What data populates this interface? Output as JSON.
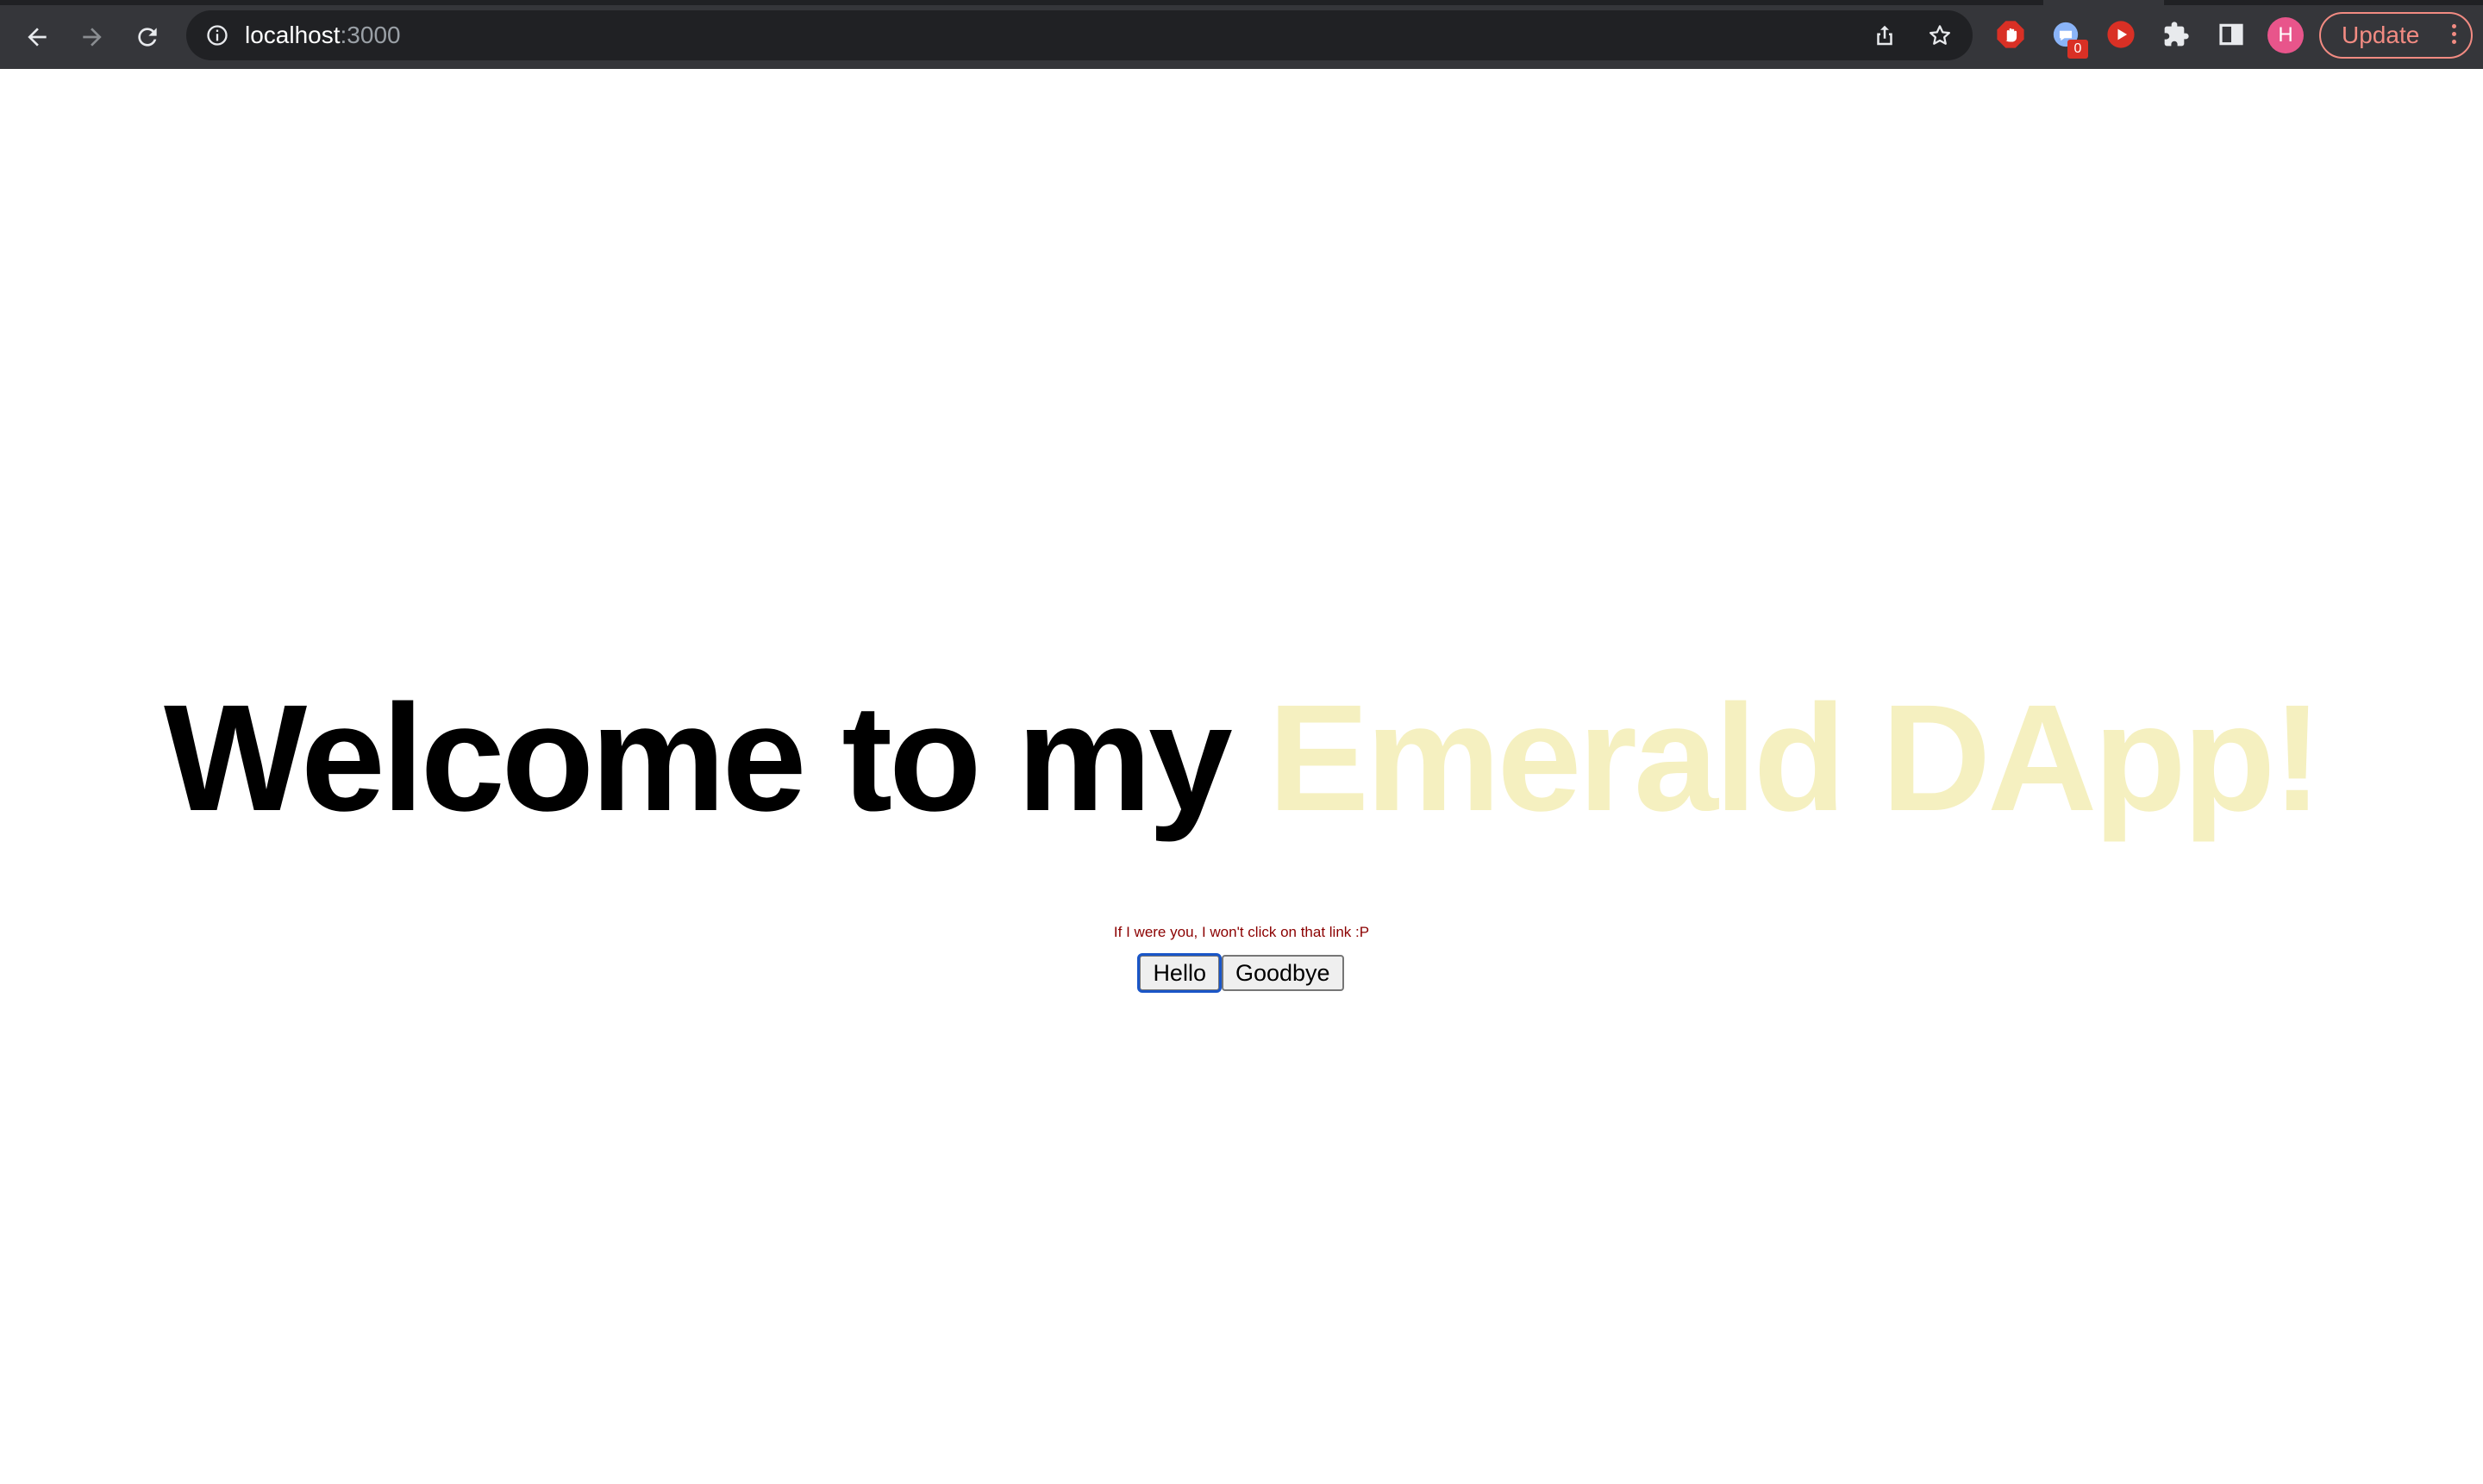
{
  "browser": {
    "url_host": "localhost",
    "url_port": ":3000",
    "update_label": "Update",
    "profile_initial": "H",
    "extension_badge_count": "0",
    "icons": {
      "back": "back-arrow-icon",
      "forward": "forward-arrow-icon",
      "reload": "reload-icon",
      "site_info": "info-icon",
      "share": "share-icon",
      "bookmark": "star-icon",
      "ext_adblock": "stop-hand-icon",
      "ext_chat": "chat-bubble-icon",
      "ext_youtube": "play-icon",
      "extensions": "puzzle-icon",
      "side_panel": "side-panel-icon",
      "menu": "vertical-dots-icon"
    }
  },
  "page": {
    "headline_main": "Welcome to my ",
    "headline_accent": "Emerald DApp!",
    "warning_text": "If I were you, I won't click on that link :P",
    "buttons": {
      "hello_label": "Hello",
      "goodbye_label": "Goodbye"
    }
  },
  "colors": {
    "chrome_bg": "#35363a",
    "omnibox_bg": "#202124",
    "accent_text": "#f5f0c0",
    "warning_text": "#8b0000",
    "update_accent": "#f28b82",
    "profile_bg": "#e8558b"
  }
}
